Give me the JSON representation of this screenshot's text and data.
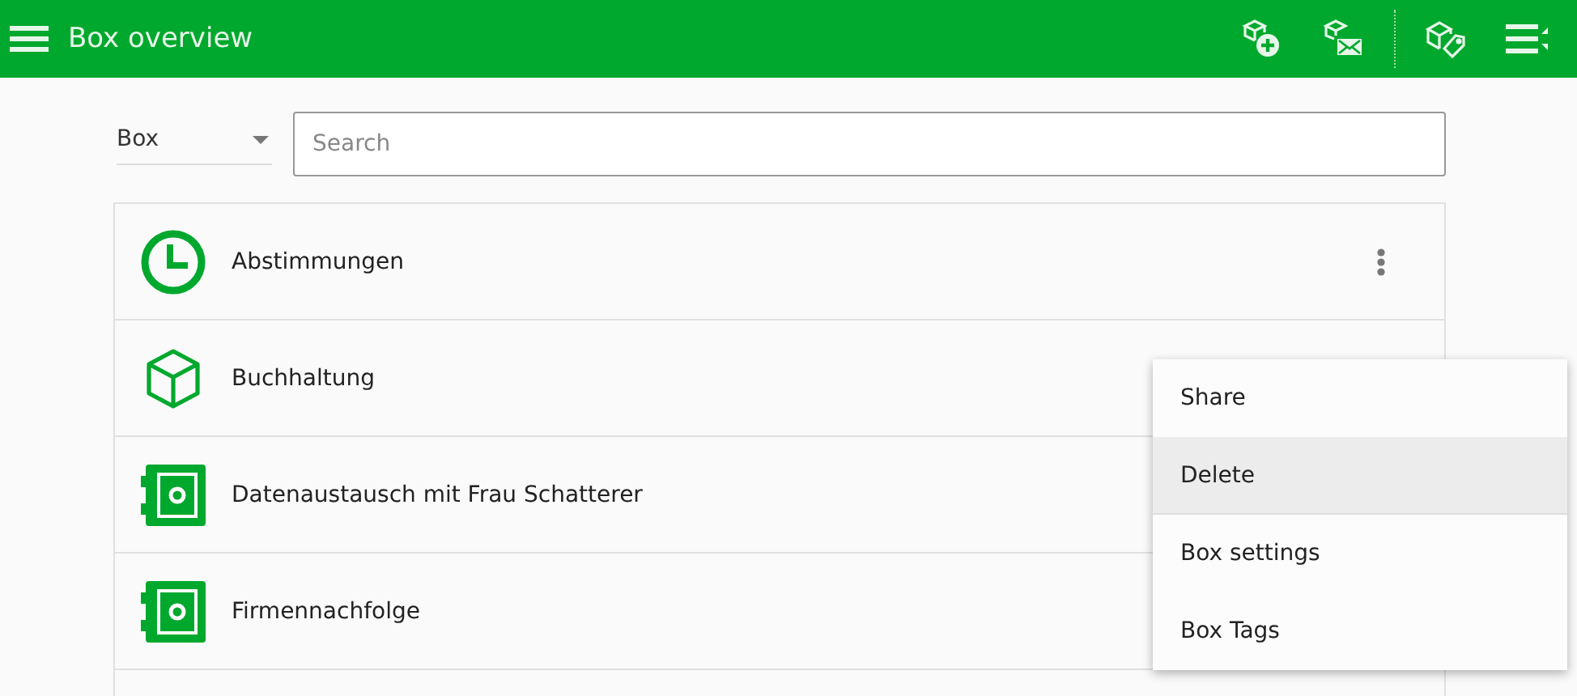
{
  "app_bar": {
    "title": "Box overview"
  },
  "filter": {
    "value": "Box"
  },
  "search": {
    "placeholder": "Search"
  },
  "boxes": [
    {
      "name": "Abstimmungen",
      "kind": "clock",
      "menu_button": true
    },
    {
      "name": "Buchhaltung",
      "kind": "cube",
      "menu_button": false
    },
    {
      "name": "Datenaustausch mit Frau Schatterer",
      "kind": "safe",
      "menu_button": false
    },
    {
      "name": "Firmennachfolge",
      "kind": "safe",
      "menu_button": false
    }
  ],
  "context_menu": [
    {
      "label": "Share",
      "selected": false,
      "divider_after": false
    },
    {
      "label": "Delete",
      "selected": true,
      "divider_after": true
    },
    {
      "label": "Box settings",
      "selected": false,
      "divider_after": false
    },
    {
      "label": "Box Tags",
      "selected": false,
      "divider_after": false
    }
  ]
}
